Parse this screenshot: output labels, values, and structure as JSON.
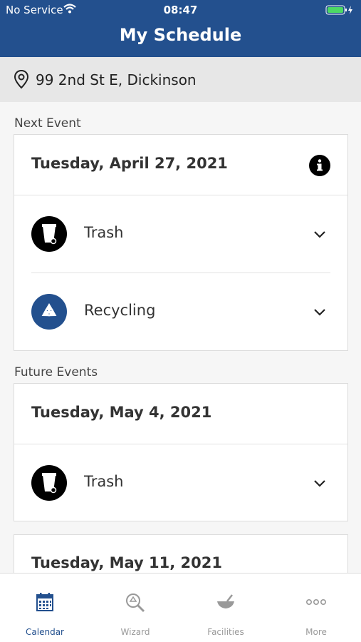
{
  "status_bar": {
    "carrier": "No Service",
    "time": "08:47"
  },
  "header": {
    "title": "My Schedule"
  },
  "address": {
    "text": "99 2nd St E, Dickinson"
  },
  "next_event": {
    "section_label": "Next Event",
    "date": "Tuesday, April 27, 2021",
    "items": [
      {
        "label": "Trash",
        "icon": "trash-bin-icon"
      },
      {
        "label": "Recycling",
        "icon": "recycle-icon"
      }
    ]
  },
  "future_events": {
    "section_label": "Future Events",
    "events": [
      {
        "date": "Tuesday, May 4, 2021",
        "items": [
          {
            "label": "Trash",
            "icon": "trash-bin-icon"
          }
        ]
      },
      {
        "date": "Tuesday, May 11, 2021"
      }
    ]
  },
  "tabs": [
    {
      "label": "Calendar",
      "icon": "calendar-icon",
      "active": true
    },
    {
      "label": "Wizard",
      "icon": "wizard-search-icon",
      "active": false
    },
    {
      "label": "Facilities",
      "icon": "facilities-icon",
      "active": false
    },
    {
      "label": "More",
      "icon": "more-dots-icon",
      "active": false
    }
  ],
  "colors": {
    "brand": "#23508e",
    "battery": "#4cd964",
    "trash": "#000000",
    "recycling": "#23508e"
  }
}
